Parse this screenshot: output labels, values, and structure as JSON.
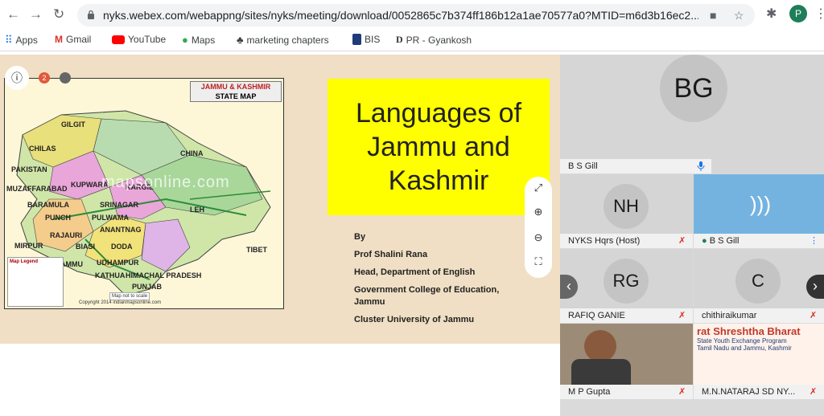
{
  "browser": {
    "url": "nyks.webex.com/webappng/sites/nyks/meeting/download/0052865c7b374ff186b12a1ae70577a0?MTID=m6d3b16ec2...",
    "profile_initial": "P"
  },
  "bookmarks": [
    {
      "label": "Apps",
      "icon": "apps-grid-icon"
    },
    {
      "label": "Gmail",
      "icon": "gmail-icon"
    },
    {
      "label": "YouTube",
      "icon": "youtube-icon"
    },
    {
      "label": "Maps",
      "icon": "maps-pin-icon"
    },
    {
      "label": "marketing chapters",
      "icon": "folder-icon"
    },
    {
      "label": "BIS",
      "icon": "bis-icon"
    },
    {
      "label": "PR - Gyankosh",
      "icon": "gyankosh-icon"
    }
  ],
  "slide": {
    "map": {
      "title_line1": "JAMMU & KASHMIR",
      "title_line2": "STATE MAP",
      "watermark": "mapsonline.com",
      "places": [
        "GILGIT",
        "CHINA",
        "CHILAS",
        "PAKISTAN",
        "MUZAFFARABAD",
        "KUPWARA",
        "KARGIL",
        "BARAMULA",
        "SRINAGAR",
        "LEH",
        "PUNCH",
        "PULWAMA",
        "RAJAURI",
        "ANANTNAG",
        "BIASI",
        "DODA",
        "MIRPUR",
        "UDHAMPUR",
        "TIBET",
        "JAMMU",
        "KATHUA",
        "HIMACHAL PRADESH",
        "PUNJAB"
      ],
      "legend_title": "Map Legend",
      "scale_note": "Map not to scale",
      "copyright": "Copyright 2014 indianmapsonline.com"
    },
    "title_lines": [
      "Languages of",
      "Jammu and",
      "Kashmir"
    ],
    "credits": {
      "by": "By",
      "name": "Prof Shalini Rana",
      "role": "Head, Department of English",
      "college_line1": "Government College of Education,",
      "college_line2": "Jammu",
      "university": "Cluster University of Jammu"
    },
    "controls": {
      "info": "ⓘ",
      "badge_count": "2"
    }
  },
  "participants": [
    {
      "initials": "BG",
      "name": "B S Gill",
      "tile": "featured",
      "muted": false
    },
    {
      "initials": "NH",
      "name": "NYKS Hqrs (Host)",
      "tile": "grid",
      "muted": true
    },
    {
      "initials": "",
      "name": "B S Gill",
      "tile": "grid-active",
      "muted": false
    },
    {
      "initials": "RG",
      "name": "RAFIQ GANIE",
      "tile": "grid",
      "muted": true
    },
    {
      "initials": "C",
      "name": "chithiraikumar",
      "tile": "grid",
      "muted": true
    },
    {
      "initials": "",
      "name": "M P Gupta",
      "tile": "video",
      "muted": true
    },
    {
      "initials": "",
      "name": "M.N.NATARAJ SD NY...",
      "tile": "video",
      "muted": true
    }
  ],
  "banner_text": {
    "line1": "rat Shreshtha Bharat",
    "line2": "State Youth Exchange Program",
    "line3": "Tamil Nadu and Jammu, Kashmir"
  },
  "colors": {
    "accent_green": "#1e7e5a",
    "slide_bg": "#f0dfc4",
    "title_box": "#ffff00",
    "muted_red": "#d93025"
  }
}
